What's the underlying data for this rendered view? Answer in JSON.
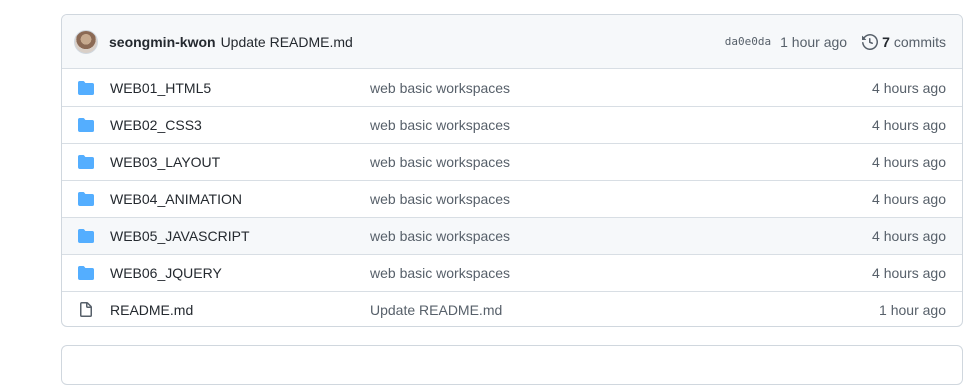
{
  "latest_commit": {
    "author": "seongmin-kwon",
    "message": "Update README.md",
    "sha": "da0e0da",
    "time": "1 hour ago",
    "commits_count": "7",
    "commits_label": "commits"
  },
  "files": [
    {
      "name": "WEB01_HTML5",
      "type": "folder",
      "message": "web basic workspaces",
      "age": "4 hours ago"
    },
    {
      "name": "WEB02_CSS3",
      "type": "folder",
      "message": "web basic workspaces",
      "age": "4 hours ago"
    },
    {
      "name": "WEB03_LAYOUT",
      "type": "folder",
      "message": "web basic workspaces",
      "age": "4 hours ago"
    },
    {
      "name": "WEB04_ANIMATION",
      "type": "folder",
      "message": "web basic workspaces",
      "age": "4 hours ago"
    },
    {
      "name": "WEB05_JAVASCRIPT",
      "type": "folder",
      "message": "web basic workspaces",
      "age": "4 hours ago"
    },
    {
      "name": "WEB06_JQUERY",
      "type": "folder",
      "message": "web basic workspaces",
      "age": "4 hours ago"
    },
    {
      "name": "README.md",
      "type": "file",
      "message": "Update README.md",
      "age": "1 hour ago"
    }
  ],
  "colors": {
    "folder_icon": "#54aeff",
    "file_icon": "#57606a",
    "border": "#d0d7de",
    "header_bg": "#f6f8fa"
  },
  "icons": {
    "history": "history-icon",
    "folder": "folder-icon",
    "file": "file-icon"
  }
}
